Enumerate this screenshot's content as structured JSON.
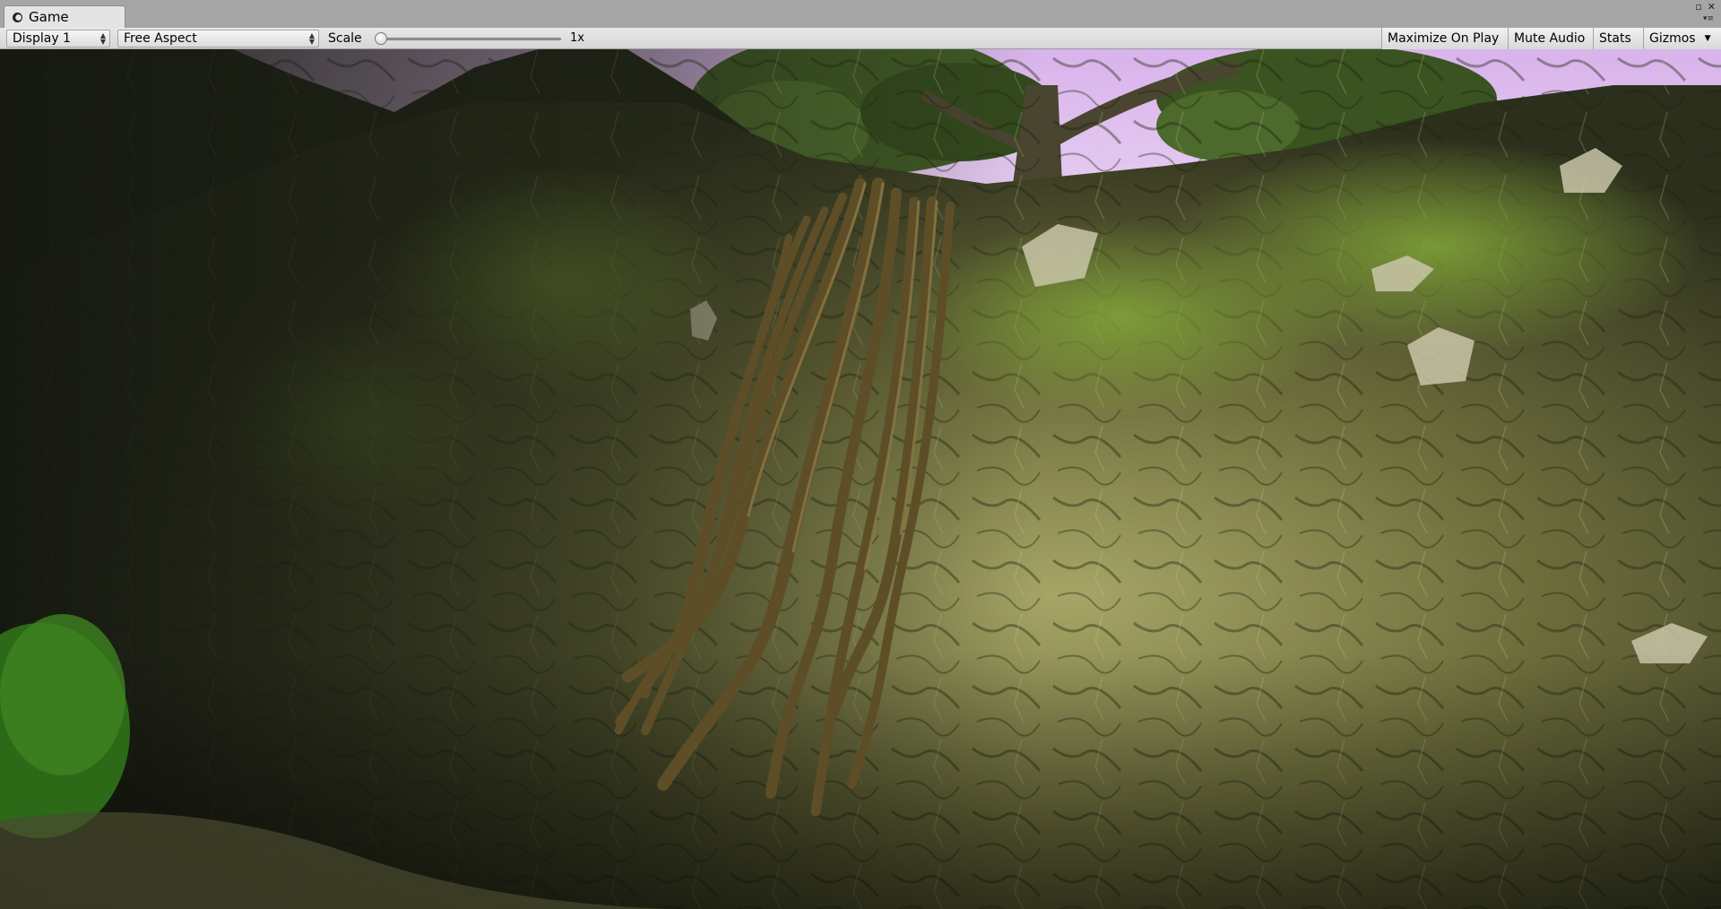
{
  "window": {
    "tab_label": "Game",
    "tab_icon": "unity-game-icon",
    "controls": [
      "maximize-icon",
      "close-icon"
    ]
  },
  "toolbar": {
    "display_select": "Display 1",
    "aspect_select": "Free Aspect",
    "scale_label": "Scale",
    "scale_value": "1x",
    "scale_level_fraction": 0.0,
    "maximize_on_play": "Maximize On Play",
    "mute_audio": "Mute Audio",
    "stats": "Stats",
    "gizmos": "Gizmos"
  },
  "viewport": {
    "scene": "game-view-render",
    "colors": {
      "sky": "#e6c6f2",
      "rock": "#5d6036",
      "moss": "#6f8a2c",
      "roots": "#5a4a26",
      "grass": "#2f6b1a"
    }
  }
}
